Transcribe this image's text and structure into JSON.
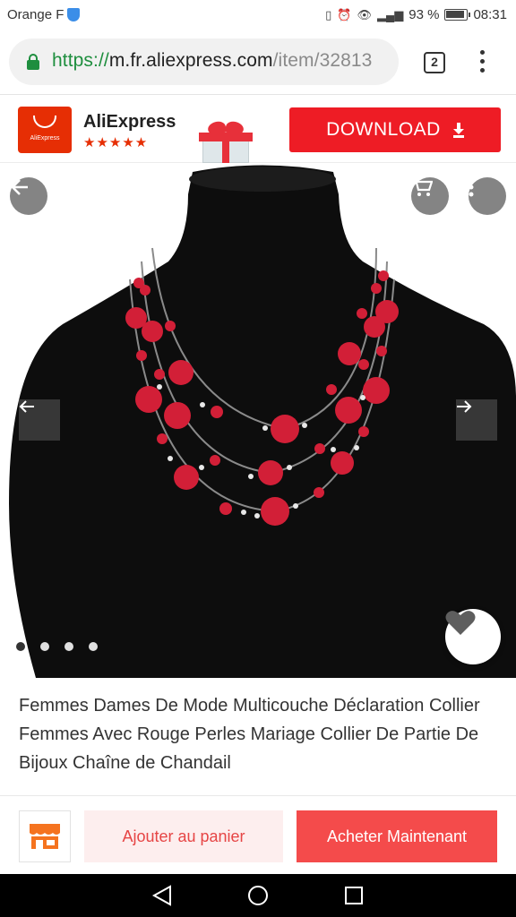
{
  "status_bar": {
    "carrier": "Orange F",
    "battery": "93 %",
    "time": "08:31"
  },
  "browser": {
    "url_scheme": "https://",
    "url_host": "m.fr.aliexpress.com",
    "url_path": "/item/32813",
    "tab_count": "2"
  },
  "app_banner": {
    "logo_text": "AliExpress",
    "app_name": "AliExpress",
    "rating_stars": "★★★★★",
    "download_label": "DOWNLOAD"
  },
  "product": {
    "title": "Femmes Dames De Mode Multicouche Déclaration Collier Femmes Avec Rouge Perles Mariage Collier De Partie De Bijoux Chaîne de Chandail",
    "image_count": 4,
    "active_image": 1
  },
  "actions": {
    "add_to_cart": "Ajouter au panier",
    "buy_now": "Acheter Maintenant"
  },
  "colors": {
    "brand_red": "#ee1c25",
    "store_orange": "#f5731f",
    "bead_red": "#d9223a"
  }
}
